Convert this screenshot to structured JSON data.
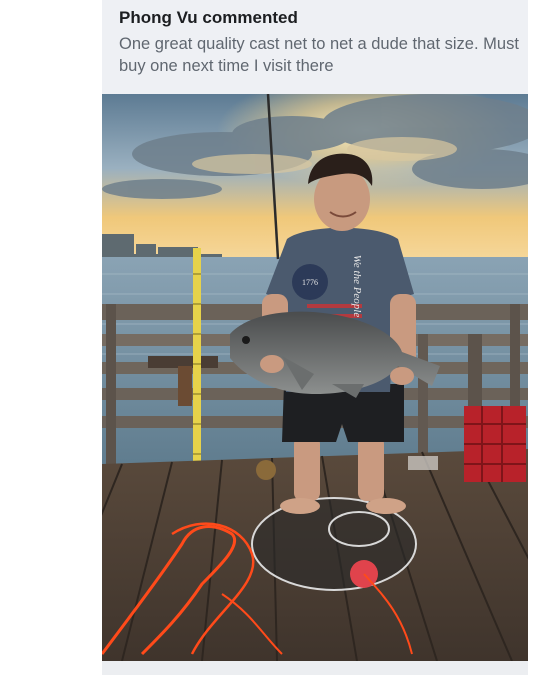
{
  "comment": {
    "author_action": "Phong Vu commented",
    "text": "One great quality cast net to net a dude that size.  Must buy one next time I visit there"
  },
  "photo": {
    "shirt_text": "We the People",
    "shirt_year": "1776"
  },
  "colors": {
    "card_background": "#f0f2f5",
    "author_text": "#1c1e21",
    "body_text": "#606770",
    "net_line": "#ff4a1a"
  }
}
